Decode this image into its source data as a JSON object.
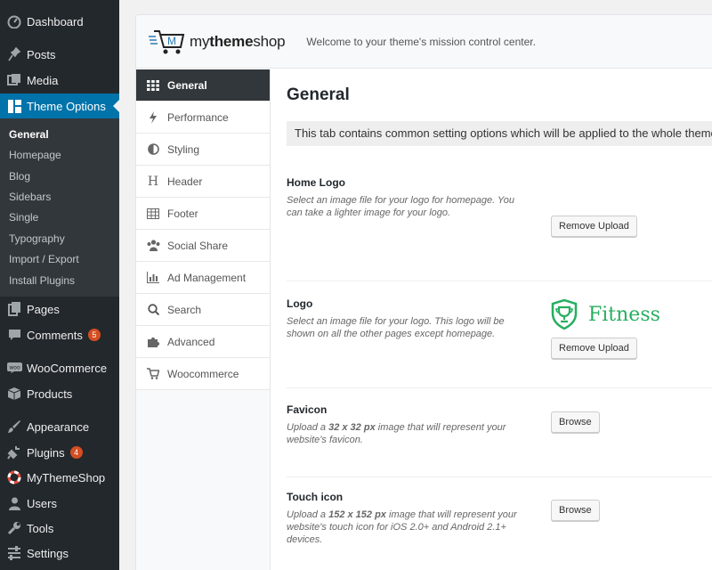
{
  "sidebar": {
    "items": [
      {
        "label": "Dashboard",
        "icon": "dashboard-icon"
      },
      {
        "label": "Posts",
        "icon": "pin-icon"
      },
      {
        "label": "Media",
        "icon": "media-icon"
      },
      {
        "label": "Theme Options",
        "icon": "layout-icon"
      },
      {
        "label": "Pages",
        "icon": "pages-icon"
      },
      {
        "label": "Comments",
        "icon": "comment-icon",
        "badge": "5"
      },
      {
        "label": "WooCommerce",
        "icon": "woo-icon"
      },
      {
        "label": "Products",
        "icon": "box-icon"
      },
      {
        "label": "Appearance",
        "icon": "brush-icon"
      },
      {
        "label": "Plugins",
        "icon": "plug-icon",
        "badge": "4"
      },
      {
        "label": "MyThemeShop",
        "icon": "lifebuoy-icon"
      },
      {
        "label": "Users",
        "icon": "user-icon"
      },
      {
        "label": "Tools",
        "icon": "wrench-icon"
      },
      {
        "label": "Settings",
        "icon": "settings-icon"
      }
    ],
    "submenu": [
      "General",
      "Homepage",
      "Blog",
      "Sidebars",
      "Single",
      "Typography",
      "Import / Export",
      "Install Plugins"
    ]
  },
  "header": {
    "logo_prefix": "my",
    "logo_theme": "theme",
    "logo_suffix": "shop",
    "tagline": "Welcome to your theme's mission control center."
  },
  "tabs": [
    {
      "label": "General",
      "icon": "grid-icon"
    },
    {
      "label": "Performance",
      "icon": "bolt-icon"
    },
    {
      "label": "Styling",
      "icon": "contrast-icon"
    },
    {
      "label": "Header",
      "icon": "heading-icon"
    },
    {
      "label": "Footer",
      "icon": "table-icon"
    },
    {
      "label": "Social Share",
      "icon": "share-icon"
    },
    {
      "label": "Ad Management",
      "icon": "chart-icon"
    },
    {
      "label": "Search",
      "icon": "search-icon"
    },
    {
      "label": "Advanced",
      "icon": "puzzle-icon"
    },
    {
      "label": "Woocommerce",
      "icon": "cart-icon"
    }
  ],
  "main": {
    "title": "General",
    "notice": "This tab contains common setting options which will be applied to the whole theme.",
    "fields": [
      {
        "title": "Home Logo",
        "desc": "Select an image file for your logo for homepage. You can take a lighter image for your logo.",
        "button": "Remove Upload"
      },
      {
        "title": "Logo",
        "desc": "Select an image file for your logo. This logo will be shown on all the other pages except homepage.",
        "button": "Remove Upload",
        "preview_text": "Fitness"
      },
      {
        "title": "Favicon",
        "desc_pre": "Upload a ",
        "desc_bold": "32 x 32 px",
        "desc_post": " image that will represent your website's favicon.",
        "button": "Browse"
      },
      {
        "title": "Touch icon",
        "desc_pre": "Upload a ",
        "desc_bold": "152 x 152 px",
        "desc_post": " image that will represent your website's touch icon for iOS 2.0+ and Android 2.1+ devices.",
        "button": "Browse"
      }
    ]
  },
  "colors": {
    "sidebar_bg": "#23282d",
    "sidebar_active": "#0073aa",
    "submenu_bg": "#32373c",
    "badge": "#d54e21",
    "fitness_green": "#27ae60",
    "logo_blue": "#2a7ab0"
  }
}
